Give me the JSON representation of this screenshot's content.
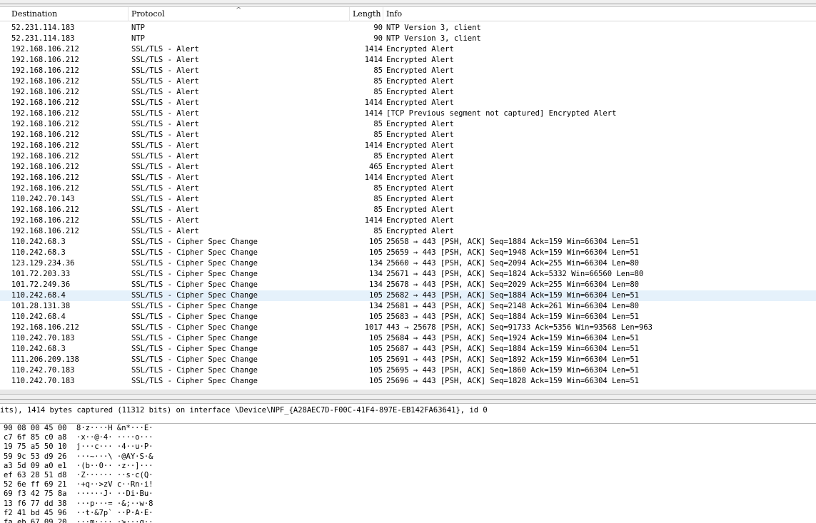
{
  "packet_list": {
    "columns": {
      "destination": "Destination",
      "protocol": "Protocol",
      "length": "Length",
      "info": "Info"
    },
    "rows": [
      {
        "destination": "52.231.114.183",
        "protocol": "NTP",
        "length": "90",
        "info": "NTP Version 3, client"
      },
      {
        "destination": "52.231.114.183",
        "protocol": "NTP",
        "length": "90",
        "info": "NTP Version 3, client"
      },
      {
        "destination": "192.168.106.212",
        "protocol": "SSL/TLS - Alert",
        "length": "1414",
        "info": "Encrypted Alert"
      },
      {
        "destination": "192.168.106.212",
        "protocol": "SSL/TLS - Alert",
        "length": "1414",
        "info": "Encrypted Alert"
      },
      {
        "destination": "192.168.106.212",
        "protocol": "SSL/TLS - Alert",
        "length": "85",
        "info": "Encrypted Alert"
      },
      {
        "destination": "192.168.106.212",
        "protocol": "SSL/TLS - Alert",
        "length": "85",
        "info": "Encrypted Alert"
      },
      {
        "destination": "192.168.106.212",
        "protocol": "SSL/TLS - Alert",
        "length": "85",
        "info": "Encrypted Alert"
      },
      {
        "destination": "192.168.106.212",
        "protocol": "SSL/TLS - Alert",
        "length": "1414",
        "info": "Encrypted Alert"
      },
      {
        "destination": "192.168.106.212",
        "protocol": "SSL/TLS - Alert",
        "length": "1414",
        "info": "[TCP Previous segment not captured] Encrypted Alert"
      },
      {
        "destination": "192.168.106.212",
        "protocol": "SSL/TLS - Alert",
        "length": "85",
        "info": "Encrypted Alert"
      },
      {
        "destination": "192.168.106.212",
        "protocol": "SSL/TLS - Alert",
        "length": "85",
        "info": "Encrypted Alert"
      },
      {
        "destination": "192.168.106.212",
        "protocol": "SSL/TLS - Alert",
        "length": "1414",
        "info": "Encrypted Alert"
      },
      {
        "destination": "192.168.106.212",
        "protocol": "SSL/TLS - Alert",
        "length": "85",
        "info": "Encrypted Alert"
      },
      {
        "destination": "192.168.106.212",
        "protocol": "SSL/TLS - Alert",
        "length": "465",
        "info": "Encrypted Alert"
      },
      {
        "destination": "192.168.106.212",
        "protocol": "SSL/TLS - Alert",
        "length": "1414",
        "info": "Encrypted Alert"
      },
      {
        "destination": "192.168.106.212",
        "protocol": "SSL/TLS - Alert",
        "length": "85",
        "info": "Encrypted Alert"
      },
      {
        "destination": "110.242.70.143",
        "protocol": "SSL/TLS - Alert",
        "length": "85",
        "info": "Encrypted Alert"
      },
      {
        "destination": "192.168.106.212",
        "protocol": "SSL/TLS - Alert",
        "length": "85",
        "info": "Encrypted Alert"
      },
      {
        "destination": "192.168.106.212",
        "protocol": "SSL/TLS - Alert",
        "length": "1414",
        "info": "Encrypted Alert"
      },
      {
        "destination": "192.168.106.212",
        "protocol": "SSL/TLS - Alert",
        "length": "85",
        "info": "Encrypted Alert"
      },
      {
        "destination": "110.242.68.3",
        "protocol": "SSL/TLS - Cipher Spec Change",
        "length": "105",
        "info": "25658 → 443 [PSH, ACK] Seq=1884 Ack=159 Win=66304 Len=51"
      },
      {
        "destination": "110.242.68.3",
        "protocol": "SSL/TLS - Cipher Spec Change",
        "length": "105",
        "info": "25659 → 443 [PSH, ACK] Seq=1948 Ack=159 Win=66304 Len=51"
      },
      {
        "destination": "123.129.234.36",
        "protocol": "SSL/TLS - Cipher Spec Change",
        "length": "134",
        "info": "25660 → 443 [PSH, ACK] Seq=2094 Ack=255 Win=66304 Len=80"
      },
      {
        "destination": "101.72.203.33",
        "protocol": "SSL/TLS - Cipher Spec Change",
        "length": "134",
        "info": "25671 → 443 [PSH, ACK] Seq=1824 Ack=5332 Win=66560 Len=80"
      },
      {
        "destination": "101.72.249.36",
        "protocol": "SSL/TLS - Cipher Spec Change",
        "length": "134",
        "info": "25678 → 443 [PSH, ACK] Seq=2029 Ack=255 Win=66304 Len=80"
      },
      {
        "destination": "110.242.68.4",
        "protocol": "SSL/TLS - Cipher Spec Change",
        "length": "105",
        "info": "25682 → 443 [PSH, ACK] Seq=1884 Ack=159 Win=66304 Len=51"
      },
      {
        "destination": "101.28.131.38",
        "protocol": "SSL/TLS - Cipher Spec Change",
        "length": "134",
        "info": "25681 → 443 [PSH, ACK] Seq=2148 Ack=261 Win=66304 Len=80"
      },
      {
        "destination": "110.242.68.4",
        "protocol": "SSL/TLS - Cipher Spec Change",
        "length": "105",
        "info": "25683 → 443 [PSH, ACK] Seq=1884 Ack=159 Win=66304 Len=51"
      },
      {
        "destination": "192.168.106.212",
        "protocol": "SSL/TLS - Cipher Spec Change",
        "length": "1017",
        "info": "443 → 25678 [PSH, ACK] Seq=91733 Ack=5356 Win=93568 Len=963"
      },
      {
        "destination": "110.242.70.183",
        "protocol": "SSL/TLS - Cipher Spec Change",
        "length": "105",
        "info": "25684 → 443 [PSH, ACK] Seq=1924 Ack=159 Win=66304 Len=51"
      },
      {
        "destination": "110.242.68.3",
        "protocol": "SSL/TLS - Cipher Spec Change",
        "length": "105",
        "info": "25687 → 443 [PSH, ACK] Seq=1884 Ack=159 Win=66304 Len=51"
      },
      {
        "destination": "111.206.209.138",
        "protocol": "SSL/TLS - Cipher Spec Change",
        "length": "105",
        "info": "25691 → 443 [PSH, ACK] Seq=1892 Ack=159 Win=66304 Len=51"
      },
      {
        "destination": "110.242.70.183",
        "protocol": "SSL/TLS - Cipher Spec Change",
        "length": "105",
        "info": "25695 → 443 [PSH, ACK] Seq=1860 Ack=159 Win=66304 Len=51"
      },
      {
        "destination": "110.242.70.183",
        "protocol": "SSL/TLS - Cipher Spec Change",
        "length": "105",
        "info": "25696 → 443 [PSH, ACK] Seq=1828 Ack=159 Win=66304 Len=51"
      }
    ],
    "selected_row": 25
  },
  "details": {
    "frame_line": "its), 1414 bytes captured (11312 bits) on interface \\Device\\NPF_{A28AEC7D-F00C-41F4-897E-EB142FA63641}, id 0"
  },
  "bytes": {
    "rows": [
      {
        "hex": "90 08 00 45 00",
        "ascii": "8·z····H &n*···E·"
      },
      {
        "hex": "c7 6f 85 c0 a8",
        "ascii": "·x··@·4· ····o···"
      },
      {
        "hex": "19 75 a5 50 10",
        "ascii": "j···c··· ·4··u·P·"
      },
      {
        "hex": "59 9c 53 d9 26",
        "ascii": "···~···\\ ·@AY·S·&"
      },
      {
        "hex": "a3 5d 09 a0 e1",
        "ascii": "·(b··0·· ·z··]···"
      },
      {
        "hex": "ef 63 28 51 d8",
        "ascii": "·Z······ ··s·c(Q·"
      },
      {
        "hex": "52 6e ff 69 21",
        "ascii": "·+q··>zV c··Rn·i!"
      },
      {
        "hex": "69 f3 42 75 8a",
        "ascii": "······J· ··Di·Bu·"
      },
      {
        "hex": "13 f6 77 dd 38",
        "ascii": "···p···= ·&;··w·8"
      },
      {
        "hex": "f2 41 bd 45 96",
        "ascii": "··t·&7p` ··P·A·E·"
      },
      {
        "hex": "fa eb 67 09 20",
        "ascii": "···m···· ·>···g··"
      }
    ]
  },
  "colors": {
    "selected_row_bg": "#e5f1fb",
    "splitter_bg": "#f0f0f0"
  }
}
